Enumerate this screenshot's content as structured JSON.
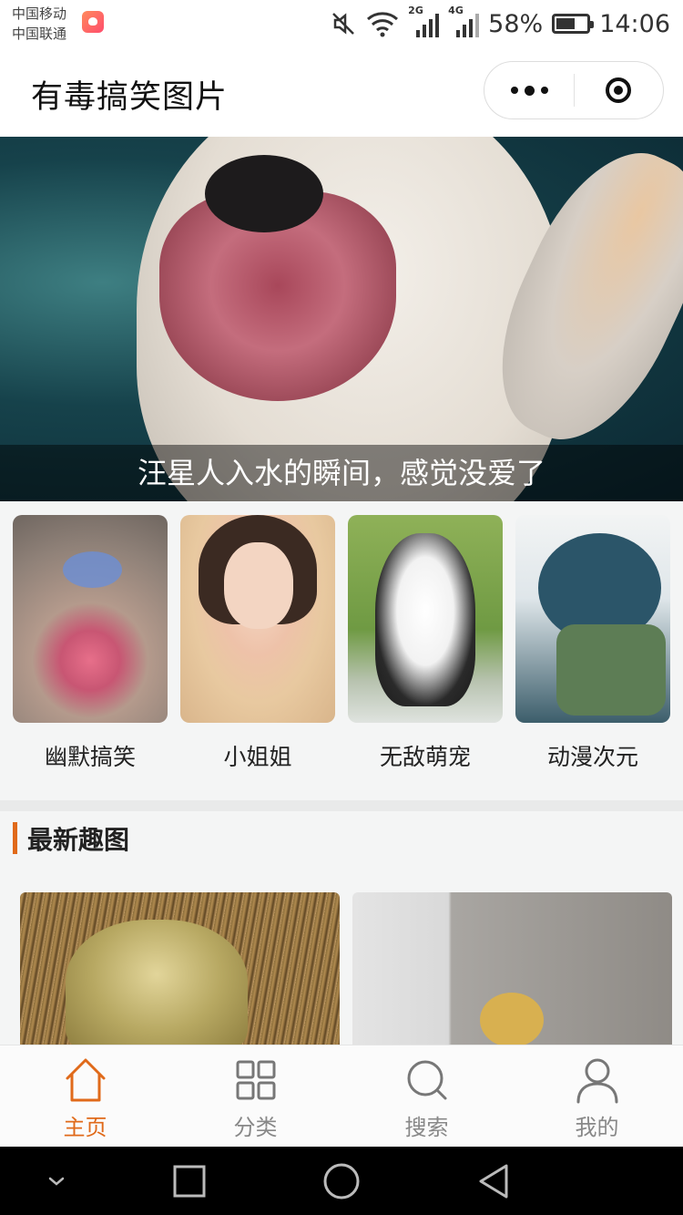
{
  "status_bar": {
    "carrier1": "中国移动",
    "carrier2": "中国联通",
    "net1": "2G",
    "net2": "4G",
    "battery": "58%",
    "time": "14:06",
    "icons": [
      "mute-icon",
      "wifi-icon",
      "signal-icon",
      "battery-icon",
      "app-notification-icon"
    ]
  },
  "navbar": {
    "title": "有毒搞笑图片"
  },
  "banner": {
    "caption": "汪星人入水的瞬间，感觉没爱了"
  },
  "categories": [
    {
      "label": "幽默搞笑"
    },
    {
      "label": "小姐姐"
    },
    {
      "label": "无敌萌宠"
    },
    {
      "label": "动漫次元"
    }
  ],
  "section": {
    "title": "最新趣图"
  },
  "tabbar": {
    "items": [
      {
        "label": "主页",
        "icon": "home-icon",
        "active": true
      },
      {
        "label": "分类",
        "icon": "grid-icon",
        "active": false
      },
      {
        "label": "搜索",
        "icon": "search-icon",
        "active": false
      },
      {
        "label": "我的",
        "icon": "user-icon",
        "active": false
      }
    ]
  },
  "colors": {
    "accent": "#e06a1a",
    "inactive_tab": "#888888"
  }
}
